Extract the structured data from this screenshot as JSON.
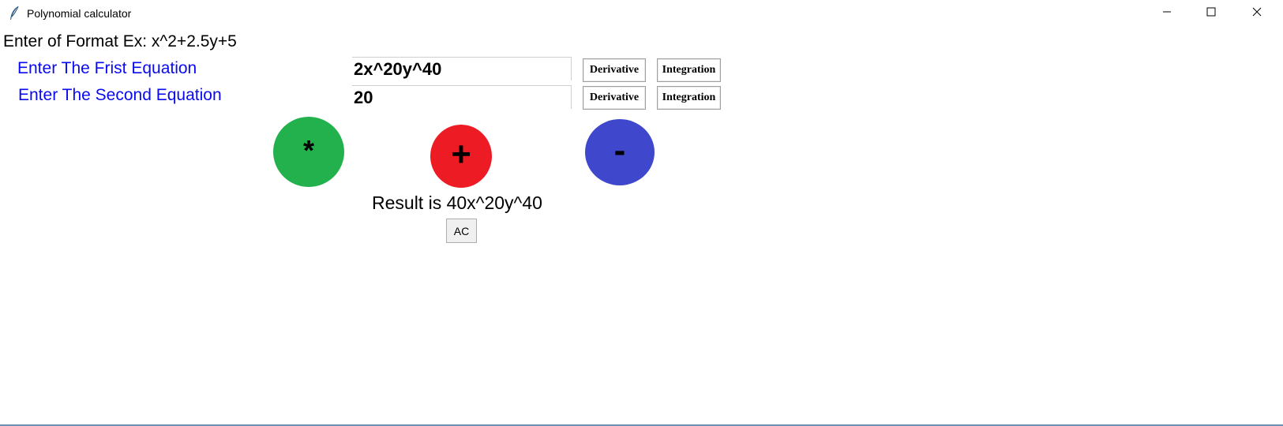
{
  "window": {
    "title": "Polynomial calculator",
    "icon": "feather-icon",
    "controls": [
      "minimize-icon",
      "maximize-icon",
      "close-icon"
    ]
  },
  "hint": "Enter of Format Ex: x^2+2.5y+5",
  "equations": [
    {
      "label": "Enter The Frist Equation",
      "value": "2x^20y^40",
      "derivative_label": "Derivative",
      "integration_label": "Integration"
    },
    {
      "label": "Enter The Second Equation",
      "value": "20",
      "derivative_label": "Derivative",
      "integration_label": "Integration"
    }
  ],
  "operations": {
    "multiply": {
      "symbol": "*",
      "color": "#22b14c"
    },
    "add": {
      "symbol": "+",
      "color": "#ed1c24"
    },
    "subtract": {
      "symbol": "-",
      "color": "#3f48cc"
    }
  },
  "result_text": "Result is 40x^20y^40",
  "ac_label": "AC",
  "colors": {
    "label_blue": "#0a0af0"
  }
}
